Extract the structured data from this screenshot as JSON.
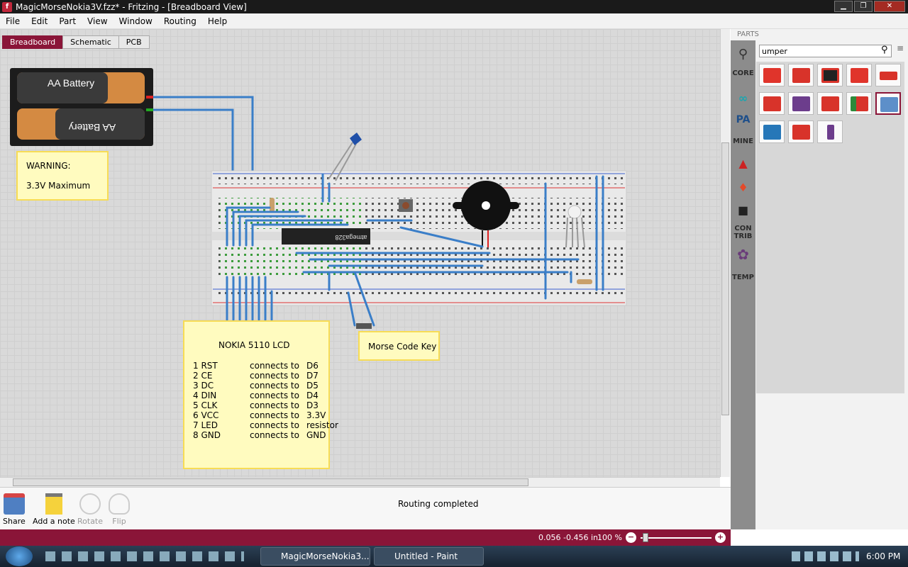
{
  "window": {
    "title": "MagicMorseNokia3V.fzz* - Fritzing - [Breadboard View]"
  },
  "menu": [
    "File",
    "Edit",
    "Part",
    "View",
    "Window",
    "Routing",
    "Help"
  ],
  "view_tabs": [
    "Breadboard",
    "Schematic",
    "PCB"
  ],
  "battery": {
    "label1": "AA Battery",
    "label2": "AA Battery"
  },
  "chip_label": "atmega328",
  "warning_note": {
    "line1": "WARNING:",
    "line2": "3.3V Maximum"
  },
  "morse_note": "Morse Code Key",
  "lcd_note": {
    "title": "NOKIA 5110 LCD",
    "rows": [
      {
        "pin": "1 RST",
        "conn": "connects to",
        "to": "D6"
      },
      {
        "pin": "2 CE",
        "conn": "connects to",
        "to": "D7"
      },
      {
        "pin": "3 DC",
        "conn": "connects to",
        "to": "D5"
      },
      {
        "pin": "4 DIN",
        "conn": "connects to",
        "to": "D4"
      },
      {
        "pin": "5 CLK",
        "conn": "connects to",
        "to": "D3"
      },
      {
        "pin": "6 VCC",
        "conn": "connects to",
        "to": "3.3V"
      },
      {
        "pin": "7 LED",
        "conn": "connects to",
        "to": "resistor"
      },
      {
        "pin": "8 GND",
        "conn": "connects to",
        "to": "GND"
      }
    ]
  },
  "toolbar": {
    "share": "Share",
    "add_note": "Add a note",
    "rotate": "Rotate",
    "flip": "Flip"
  },
  "status": {
    "message": "Routing completed",
    "coords": "0.056 -0.456 in",
    "zoom": "100",
    "zoom_unit": "%"
  },
  "parts": {
    "header": "PARTS",
    "search_value": "umper",
    "bins": [
      "CORE",
      "MINE",
      "CON TRIB",
      "TEMP"
    ]
  },
  "taskbar": {
    "item1": "MagicMorseNokia3...",
    "item2": "Untitled - Paint",
    "clock": "6:00 PM"
  }
}
